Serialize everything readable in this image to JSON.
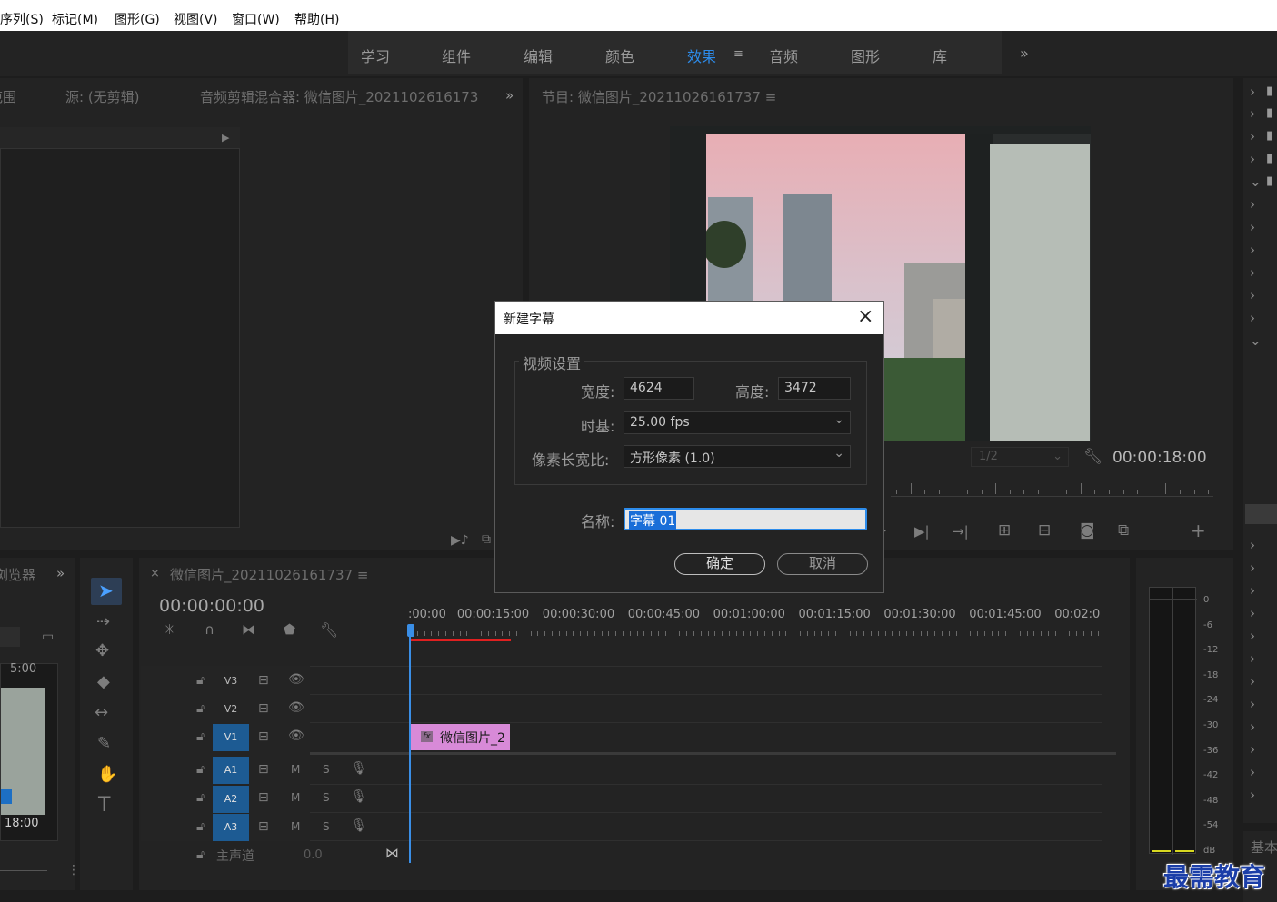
{
  "menu": [
    "序列(S)",
    "标记(M)",
    "图形(G)",
    "视图(V)",
    "窗口(W)",
    "帮助(H)"
  ],
  "workspaces": [
    "学习",
    "组件",
    "编辑",
    "颜色",
    "效果",
    "音频",
    "图形",
    "库"
  ],
  "workspaces_more": "»",
  "panels": {
    "left_tab1": "范围",
    "left_tab2": "源: (无剪辑)",
    "left_tab3": "音频剪辑混合器: 微信图片_2021102616173",
    "program_title": "节目: 微信图片_20211026161737 ≡",
    "program_timecode": "00:00:18:00",
    "program_zoom": "1/2",
    "project_label": "浏览器",
    "project_thumb_time": "5:00",
    "project_thumb_duration": "18:00",
    "basic_label": "基本"
  },
  "timeline": {
    "tab": "微信图片_20211026161737 ≡",
    "timecode": "00:00:00:00",
    "ruler": [
      ":00:00",
      "00:00:15:00",
      "00:00:30:00",
      "00:00:45:00",
      "00:01:00:00",
      "00:01:15:00",
      "00:01:30:00",
      "00:01:45:00",
      "00:02:0"
    ],
    "tracks_video": [
      "V3",
      "V2",
      "V1"
    ],
    "tracks_audio": [
      "A1",
      "A2",
      "A3"
    ],
    "audio_m": "M",
    "audio_s": "S",
    "master_label": "主声道",
    "master_value": "0.0",
    "clip_label": "微信图片_2",
    "clip_fx": "fx",
    "clip_color": "#d88ad8"
  },
  "meter_scale": [
    "0",
    "-6",
    "-12",
    "-18",
    "-24",
    "-30",
    "-36",
    "-42",
    "-48",
    "-54",
    "dB"
  ],
  "dialog": {
    "title": "新建字幕",
    "group": "视频设置",
    "width_label": "宽度:",
    "width_value": "4624",
    "height_label": "高度:",
    "height_value": "3472",
    "timebase_label": "时基:",
    "timebase_value": "25.00 fps",
    "par_label": "像素长宽比:",
    "par_value": "方形像素 (1.0)",
    "name_label": "名称:",
    "name_value": "字幕 01",
    "ok": "确定",
    "cancel": "取消"
  },
  "watermark": "最需教育",
  "colors": {
    "accent": "#2d8ceb",
    "track_on": "#1d5b93",
    "playhead": "#3a8ee6",
    "work_bar": "#e02020"
  }
}
